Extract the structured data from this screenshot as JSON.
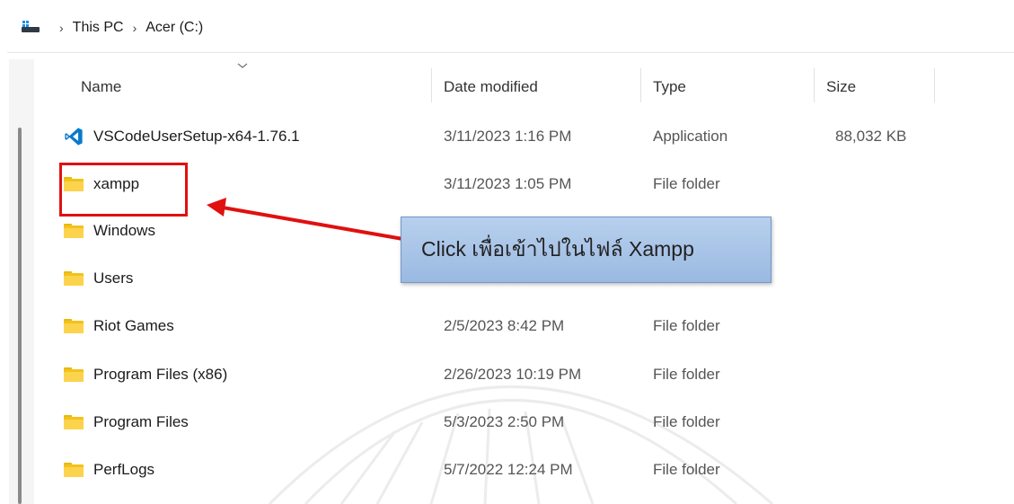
{
  "breadcrumb": {
    "items": [
      "This PC",
      "Acer (C:)"
    ],
    "separator": "›"
  },
  "columns": {
    "name": "Name",
    "date_modified": "Date modified",
    "type": "Type",
    "size": "Size"
  },
  "rows": [
    {
      "name": "VSCodeUserSetup-x64-1.76.1",
      "date": "3/11/2023 1:16 PM",
      "type": "Application",
      "size": "88,032 KB",
      "icon": "vscode-icon"
    },
    {
      "name": "xampp",
      "date": "3/11/2023 1:05 PM",
      "type": "File folder",
      "size": "",
      "icon": "folder-icon"
    },
    {
      "name": "Windows",
      "date": "",
      "type": "",
      "size": "",
      "icon": "folder-icon"
    },
    {
      "name": "Users",
      "date": "",
      "type": "",
      "size": "",
      "icon": "folder-icon"
    },
    {
      "name": "Riot Games",
      "date": "2/5/2023 8:42 PM",
      "type": "File folder",
      "size": "",
      "icon": "folder-icon"
    },
    {
      "name": "Program Files (x86)",
      "date": "2/26/2023 10:19 PM",
      "type": "File folder",
      "size": "",
      "icon": "folder-icon"
    },
    {
      "name": "Program Files",
      "date": "5/3/2023 2:50 PM",
      "type": "File folder",
      "size": "",
      "icon": "folder-icon"
    },
    {
      "name": "PerfLogs",
      "date": "5/7/2022 12:24 PM",
      "type": "File folder",
      "size": "",
      "icon": "folder-icon"
    }
  ],
  "annotation": {
    "callout_text": "Click เพื่อเข้าไปในไฟล์ Xampp",
    "highlight_color": "#e01010",
    "arrow_color": "#e01010",
    "callout_color": "#a9c5e8"
  },
  "colors": {
    "folder": "#f3c21b",
    "vscode": "#0a7acc"
  }
}
